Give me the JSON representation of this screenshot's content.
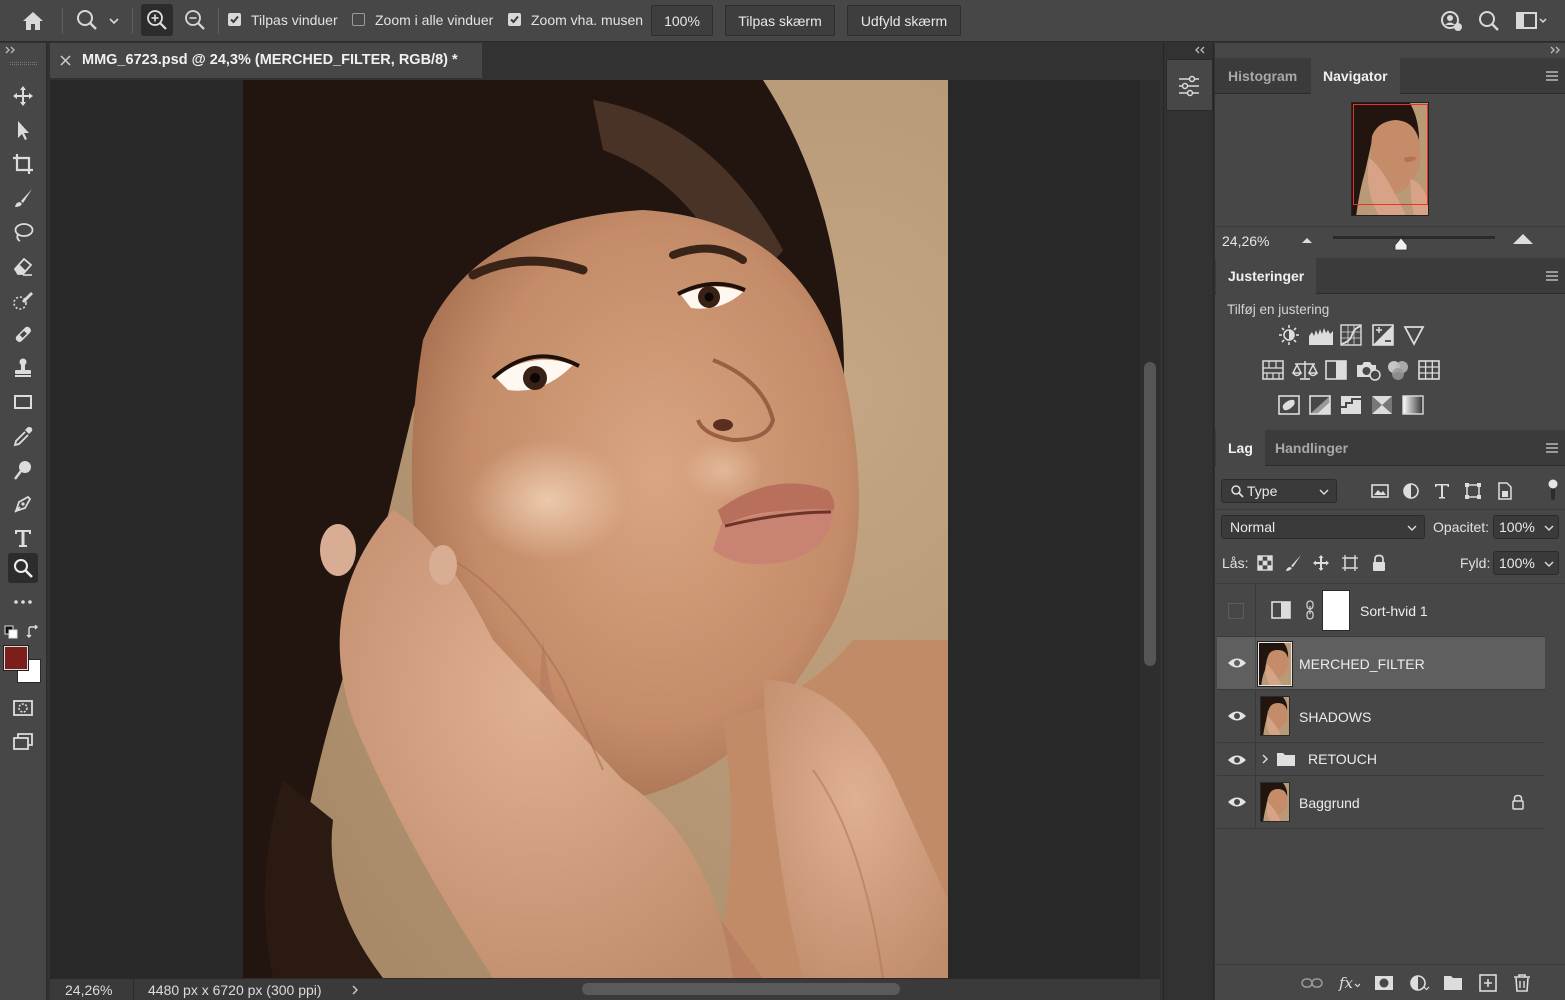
{
  "options": {
    "fit_windows_label": "Tilpas vinduer",
    "fit_windows_checked": true,
    "zoom_all_label": "Zoom i alle vinduer",
    "zoom_all_checked": false,
    "scrubby_label": "Zoom vha. musen",
    "scrubby_checked": true,
    "zoom_value": "100%",
    "fit_screen_label": "Tilpas skærm",
    "fill_screen_label": "Udfyld skærm"
  },
  "document": {
    "tab_title": "MMG_6723.psd @ 24,3% (MERCHED_FILTER, RGB/8) *",
    "status_zoom": "24,26%",
    "status_info": "4480 px x 6720 px (300 ppi)"
  },
  "colors": {
    "foreground": "#7a1f1c",
    "background": "#ffffff",
    "accent": "#4a8fe0"
  },
  "navigator": {
    "tabs": [
      "Histogram",
      "Navigator"
    ],
    "active_tab": "Navigator",
    "zoom": "24,26%",
    "zoom_slider_level": 0.42
  },
  "adjustments": {
    "title": "Justeringer",
    "subtitle": "Tilføj en justering",
    "row1": [
      "brightness-contrast-icon",
      "levels-icon",
      "curves-icon",
      "exposure-icon",
      "vibrance-icon"
    ],
    "row2": [
      "hue-saturation-icon",
      "color-balance-icon",
      "black-white-icon",
      "photo-filter-icon",
      "channel-mixer-icon",
      "color-lookup-icon"
    ],
    "row3": [
      "invert-icon",
      "posterize-icon",
      "threshold-icon",
      "selective-color-icon",
      "gradient-map-icon"
    ]
  },
  "layers_panel": {
    "tabs": [
      "Lag",
      "Handlinger"
    ],
    "active_tab": "Lag",
    "filter_kind": "Type",
    "blend_mode": "Normal",
    "opacity_label": "Opacitet:",
    "opacity_value": "100%",
    "lock_label": "Lås:",
    "fill_label": "Fyld:",
    "fill_value": "100%",
    "layers": [
      {
        "name": "Sort-hvid 1",
        "type": "adjustment",
        "visible": false,
        "selected": false
      },
      {
        "name": "MERCHED_FILTER",
        "type": "pixel",
        "visible": true,
        "selected": true
      },
      {
        "name": "SHADOWS",
        "type": "pixel",
        "visible": true,
        "selected": false
      },
      {
        "name": "RETOUCH",
        "type": "group",
        "visible": true,
        "selected": false
      },
      {
        "name": "Baggrund",
        "type": "pixel",
        "visible": true,
        "selected": false,
        "locked": true
      }
    ]
  }
}
